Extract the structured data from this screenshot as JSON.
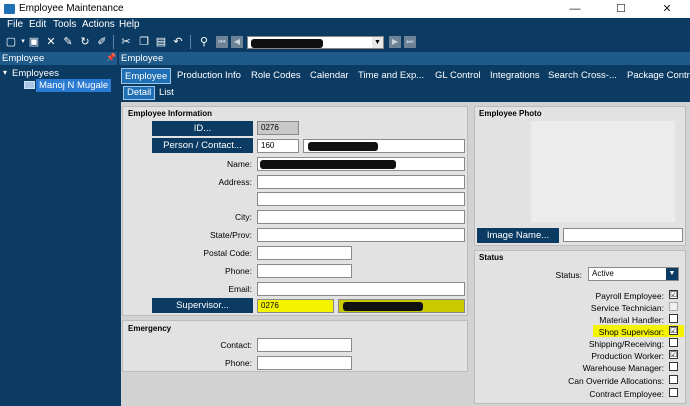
{
  "window": {
    "title": "Employee Maintenance",
    "minimize": "—",
    "maximize": "☐",
    "close": "✕"
  },
  "menu": [
    "File",
    "Edit",
    "Tools",
    "Actions",
    "Help"
  ],
  "leftpane": {
    "header": "Employee",
    "pin": "📌",
    "tree_root": "Employees",
    "tree_item": "Manoj N Mugale"
  },
  "main": {
    "header": "Employee",
    "tabs": [
      "Employee",
      "Production Info",
      "Role Codes",
      "Calendar",
      "Time and Exp...",
      "GL Control",
      "Integrations",
      "Search",
      "Cross-...",
      "Package Control"
    ],
    "subtabs": [
      "Detail",
      "List"
    ]
  },
  "employee_info": {
    "title": "Employee Information",
    "id_button": "ID...",
    "id_value": "0276",
    "person_button": "Person / Contact...",
    "person_value": "160",
    "labels": {
      "name": "Name:",
      "address": "Address:",
      "city": "City:",
      "state": "State/Prov:",
      "postal": "Postal Code:",
      "phone": "Phone:",
      "email": "Email:"
    },
    "supervisor_button": "Supervisor...",
    "supervisor_value": "0276"
  },
  "emergency": {
    "title": "Emergency",
    "contact_label": "Contact:",
    "phone_label": "Phone:"
  },
  "photo": {
    "title": "Employee Photo",
    "image_button": "Image Name..."
  },
  "status": {
    "title": "Status",
    "status_label": "Status:",
    "status_value": "Active",
    "checks": [
      {
        "label": "Payroll Employee:",
        "checked": "☑"
      },
      {
        "label": "Service Technician:",
        "checked": ""
      },
      {
        "label": "Material Handler:",
        "checked": ""
      },
      {
        "label": "Shop Supervisor:",
        "checked": "☑"
      },
      {
        "label": "Shipping/Receiving:",
        "checked": ""
      },
      {
        "label": "Production Worker:",
        "checked": "☑"
      },
      {
        "label": "Warehouse Manager:",
        "checked": ""
      },
      {
        "label": "Can Override Allocations:",
        "checked": ""
      },
      {
        "label": "Contract Employee:",
        "checked": ""
      }
    ]
  },
  "colors": {
    "navy": "#0b3b63",
    "tab_blue": "#1f6fb5",
    "highlight": "#f4f400"
  }
}
